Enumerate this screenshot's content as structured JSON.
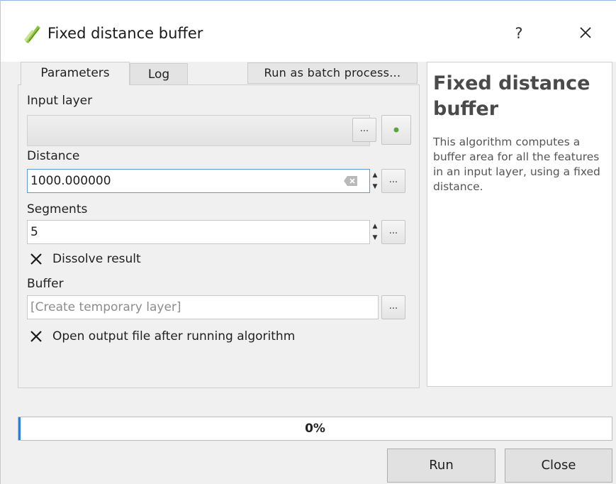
{
  "window": {
    "title": "Fixed distance buffer",
    "help_glyph": "?",
    "icon": "qgis-buffer-icon"
  },
  "tabs": [
    {
      "label": "Parameters",
      "active": true
    },
    {
      "label": "Log",
      "active": false
    }
  ],
  "batch_button": "Run as batch process...",
  "params": {
    "input_layer_label": "Input layer",
    "input_layer_value": "",
    "distance_label": "Distance",
    "distance_value": "1000.000000",
    "segments_label": "Segments",
    "segments_value": "5",
    "dissolve_label": "Dissolve result",
    "dissolve_checked": true,
    "buffer_label": "Buffer",
    "buffer_placeholder": "[Create temporary layer]",
    "open_output_label": "Open output file after running algorithm",
    "open_output_checked": true,
    "ellipsis": "..."
  },
  "help": {
    "title": "Fixed distance buffer",
    "description": "This algorithm computes a buffer area for all the features in an input layer, using a fixed distance."
  },
  "progress": {
    "text": "0%",
    "value": 0
  },
  "buttons": {
    "run": "Run",
    "close": "Close"
  },
  "colors": {
    "accent": "#2e7ed8",
    "focus_border": "#5e9ad8"
  }
}
